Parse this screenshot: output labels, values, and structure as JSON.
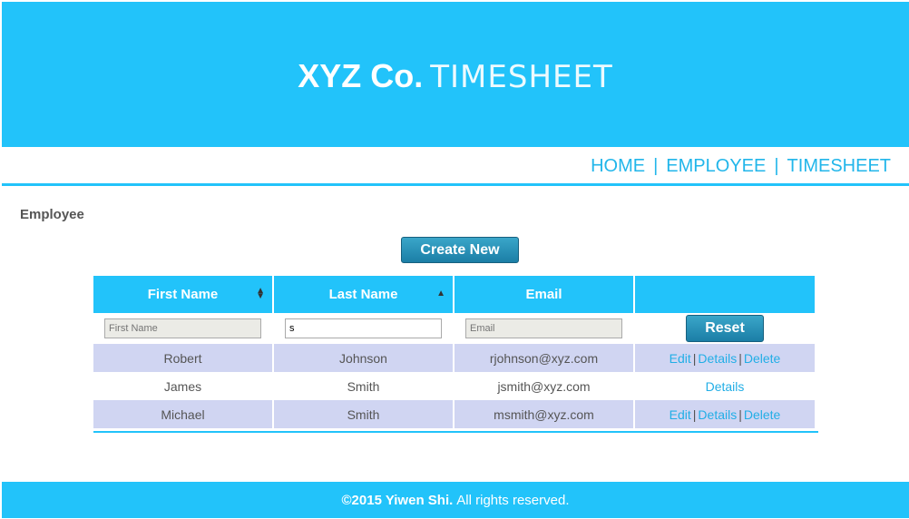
{
  "header": {
    "brand_strong": "XYZ Co.",
    "brand_light": "TIMESHEET"
  },
  "nav": {
    "items": [
      "HOME",
      "EMPLOYEE",
      "TIMESHEET"
    ],
    "separator": "|"
  },
  "page": {
    "section_title": "Employee",
    "create_button": "Create New"
  },
  "table": {
    "columns": [
      "First Name",
      "Last Name",
      "Email",
      ""
    ],
    "filters": {
      "first_name_placeholder": "First Name",
      "last_name_value": "s",
      "email_placeholder": "Email",
      "reset_label": "Reset"
    },
    "rows": [
      {
        "first": "Robert",
        "last": "Johnson",
        "email": "rjohnson@xyz.com",
        "actions": [
          "Edit",
          "Details",
          "Delete"
        ]
      },
      {
        "first": "James",
        "last": "Smith",
        "email": "jsmith@xyz.com",
        "actions": [
          "Details"
        ]
      },
      {
        "first": "Michael",
        "last": "Smith",
        "email": "msmith@xyz.com",
        "actions": [
          "Edit",
          "Details",
          "Delete"
        ]
      }
    ]
  },
  "footer": {
    "copyright": "©2015 Yiwen Shi.",
    "rights": "All rights reserved."
  },
  "colors": {
    "accent": "#22c3fa",
    "row_alt": "#d0d5f2",
    "link": "#22aee6",
    "button": "#1b7ea6"
  }
}
